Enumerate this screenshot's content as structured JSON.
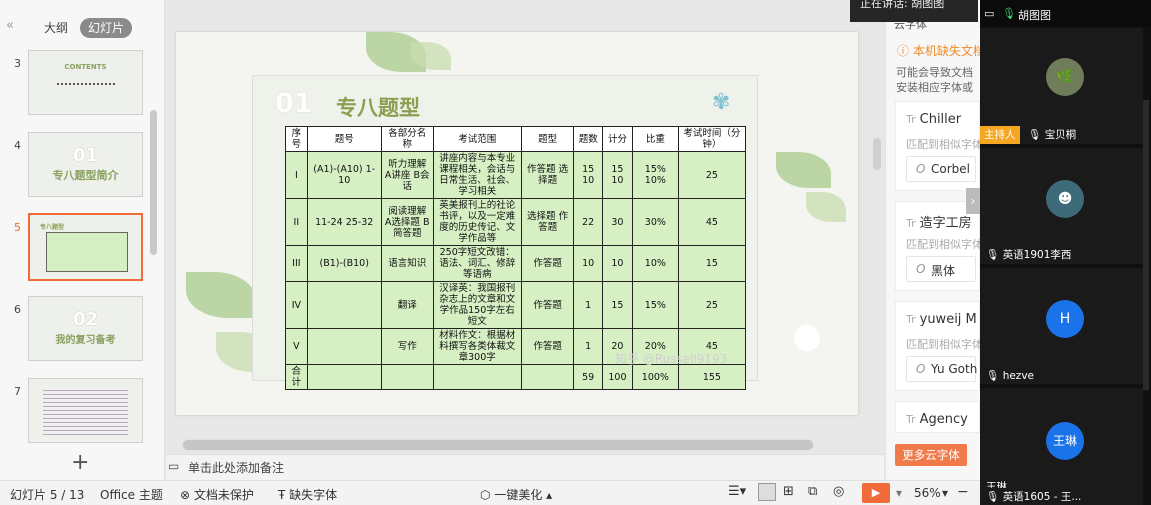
{
  "left_panel": {
    "collapse_icon": "double-chevron-left-icon",
    "tabs": [
      {
        "label": "大纲",
        "active": false
      },
      {
        "label": "幻灯片",
        "active": true
      }
    ],
    "thumbnails": [
      {
        "num": "3",
        "text": "CONTENTS",
        "selected": false
      },
      {
        "num": "4",
        "text": "专八题型简介",
        "big": "01",
        "selected": false
      },
      {
        "num": "5",
        "text": "专八题型",
        "selected": true
      },
      {
        "num": "6",
        "text": "我的复习备考",
        "big": "02",
        "selected": false
      },
      {
        "num": "7",
        "text": "",
        "selected": false
      }
    ],
    "add_label": "+"
  },
  "slide": {
    "num": "01",
    "title": "专八题型",
    "table": {
      "headers": [
        "序号",
        "题号",
        "各部分名称",
        "考试范围",
        "题型",
        "题数",
        "计分",
        "比重",
        "考试时间（分钟）"
      ],
      "rows": [
        [
          "I",
          "(A1)-(A10) 1-10",
          "听力理解 A讲座 B会话",
          "讲座内容与本专业课程相关，会话与日常生活、社会、学习相关",
          "作答题 选择题",
          "15 10",
          "15 10",
          "15% 10%",
          "25"
        ],
        [
          "II",
          "11-24 25-32",
          "阅读理解 A选择题 B简答题",
          "英美报刊上的社论书评，以及一定难度的历史传记、文学作品等",
          "选择题 作答题",
          "22",
          "30",
          "30%",
          "45"
        ],
        [
          "III",
          "(B1)-(B10)",
          "语言知识",
          "250字短文改错：语法、词汇、修辞等语病",
          "作答题",
          "10",
          "10",
          "10%",
          "15"
        ],
        [
          "IV",
          "",
          "翻译",
          "汉译英：我国报刊杂志上的文章和文学作品150字左右短文",
          "作答题",
          "1",
          "15",
          "15%",
          "25"
        ],
        [
          "V",
          "",
          "写作",
          "材料作文：根据材料撰写各类体裁文章300字",
          "作答题",
          "1",
          "20",
          "20%",
          "45"
        ],
        [
          "合计",
          "",
          "",
          "",
          "",
          "59",
          "100",
          "100%",
          "155"
        ]
      ]
    },
    "watermark": "知乎 @Russell9193"
  },
  "notes_placeholder": "单击此处添加备注",
  "font_panel": {
    "header": "云字体",
    "warning": "本机缺失文档",
    "warning_desc_1": "可能会导致文档",
    "warning_desc_2": "安装相应字体或",
    "fonts": [
      {
        "name": "Chiller",
        "desc": "匹配到相似字体",
        "replacement": "Corbel"
      },
      {
        "name": "造字工房",
        "desc": "匹配到相似字体",
        "replacement": "黑体"
      },
      {
        "name": "yuweij M",
        "desc": "匹配到相似字体",
        "replacement": "Yu Goth"
      },
      {
        "name": "Agency",
        "desc": "",
        "replacement": ""
      }
    ],
    "more_button": "更多云字体"
  },
  "meeting": {
    "speaking_tooltip": "正在讲话: 胡图图",
    "header_name": "胡图图",
    "participants": [
      {
        "name": "宝贝桐",
        "host_badge": "主持人",
        "avatar_type": "plant"
      },
      {
        "name": "英语1901李西",
        "avatar_type": "cartoon"
      },
      {
        "name": "hezve",
        "avatar_letter": "H"
      },
      {
        "name": "王琳",
        "avatar_letter": "王琳"
      },
      {
        "name": "英语1605 - 王..."
      }
    ],
    "colors": {
      "avatar_blue": "#1a73e8",
      "host_badge": "#f5a623"
    }
  },
  "status_bar": {
    "slide_indicator": "幻灯片 5 / 13",
    "theme": "Office 主题",
    "protect": "文档未保护",
    "missing_font": "缺失字体",
    "beautify": "一键美化",
    "zoom": "56%"
  },
  "colors": {
    "accent": "#f06a3a",
    "table_bg": "#d6f0c4",
    "title_green": "#8c9f51"
  }
}
